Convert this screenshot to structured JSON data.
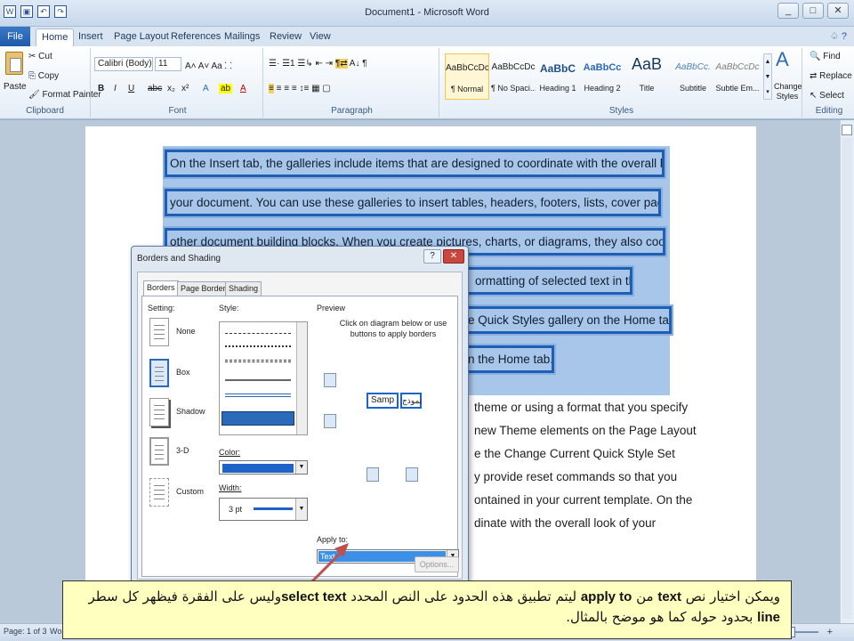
{
  "window": {
    "title": "Document1 - Microsoft Word",
    "controls": [
      "_",
      "□",
      "✕"
    ]
  },
  "qat": [
    "W",
    "💾",
    "↶",
    "↷"
  ],
  "tabs": {
    "file": "File",
    "items": [
      "Home",
      "Insert",
      "Page Layout",
      "References",
      "Mailings",
      "Review",
      "View"
    ],
    "active": "Home",
    "help": "♤ ?"
  },
  "ribbon": {
    "clipboard": {
      "paste": "Paste",
      "cut": "Cut",
      "copy": "Copy",
      "format_painter": "Format Painter",
      "label": "Clipboard"
    },
    "font": {
      "name": "Calibri (Body)",
      "size": "11",
      "label": "Font",
      "buttons": [
        "B",
        "I",
        "U",
        "abc",
        "x₂",
        "x²",
        "A",
        "A"
      ]
    },
    "paragraph": {
      "label": "Paragraph"
    },
    "styles": {
      "label": "Styles",
      "items": [
        {
          "sample": "AaBbCcDc",
          "name": "¶ Normal",
          "selected": true
        },
        {
          "sample": "AaBbCcDc",
          "name": "¶ No Spaci...",
          "selected": false
        },
        {
          "sample": "AaBbC",
          "name": "Heading 1",
          "selected": false
        },
        {
          "sample": "AaBbCc",
          "name": "Heading 2",
          "selected": false
        },
        {
          "sample": "AaB",
          "name": "Title",
          "selected": false
        },
        {
          "sample": "AaBbCc.",
          "name": "Subtitle",
          "selected": false
        },
        {
          "sample": "AaBbCcDc",
          "name": "Subtle Em...",
          "selected": false
        }
      ],
      "change_styles": "Change Styles"
    },
    "editing": {
      "find": "Find",
      "replace": "Replace",
      "select": "Select",
      "label": "Editing"
    }
  },
  "document": {
    "selected_lines": [
      "On the Insert tab, the galleries include items that are designed to coordinate with the overall look of",
      "your document. You can use these galleries to insert tables, headers, footers, lists, cover pages, and",
      "other document building blocks. When you create pictures, charts, or diagrams, they also coordinate",
      "ormatting of selected text in the",
      "e Quick Styles gallery on the Home tab.",
      "n the Home tab."
    ],
    "plain_lines": [
      "theme or using a format that you specify",
      "new Theme elements on the Page Layout",
      "e the Change Current Quick Style Set",
      "y provide reset commands so that you",
      "ontained in your current template. On the",
      "dinate with the overall look of your"
    ]
  },
  "dialog": {
    "title": "Borders and Shading",
    "help": "?",
    "close": "✕",
    "tabs": [
      "Borders",
      "Page Border",
      "Shading"
    ],
    "active_tab": "Borders",
    "setting_label": "Setting:",
    "settings": [
      "None",
      "Box",
      "Shadow",
      "3-D",
      "Custom"
    ],
    "selected_setting": "Box",
    "style_label": "Style:",
    "color_label": "Color:",
    "color_value": "#1c64c8",
    "width_label": "Width:",
    "width_value": "3 pt",
    "preview_label": "Preview",
    "preview_hint": "Click on diagram below or use buttons to apply borders",
    "sample_text": "Samp",
    "sample_arabic": "نموذج",
    "apply_to_label": "Apply to:",
    "apply_to_value": "Text",
    "options_button": "Options..."
  },
  "statusbar": {
    "page": "Page: 1 of 3",
    "words": "Wo"
  },
  "callout": {
    "segments": [
      {
        "text": "ويمكن اختيار نص ",
        "bold": false
      },
      {
        "text": "text",
        "bold": true
      },
      {
        "text": " من ",
        "bold": false
      },
      {
        "text": "apply to",
        "bold": true
      },
      {
        "text": " ليتم تطبيق هذه الحدود على النص المحدد ",
        "bold": false
      },
      {
        "text": "select text",
        "bold": true
      },
      {
        "text": "وليس على الفقرة فيظهر كل سطر ",
        "bold": false
      },
      {
        "text": "line",
        "bold": true
      },
      {
        "text": " بحدود حوله كما هو موضح بالمثال.",
        "bold": false
      }
    ]
  }
}
